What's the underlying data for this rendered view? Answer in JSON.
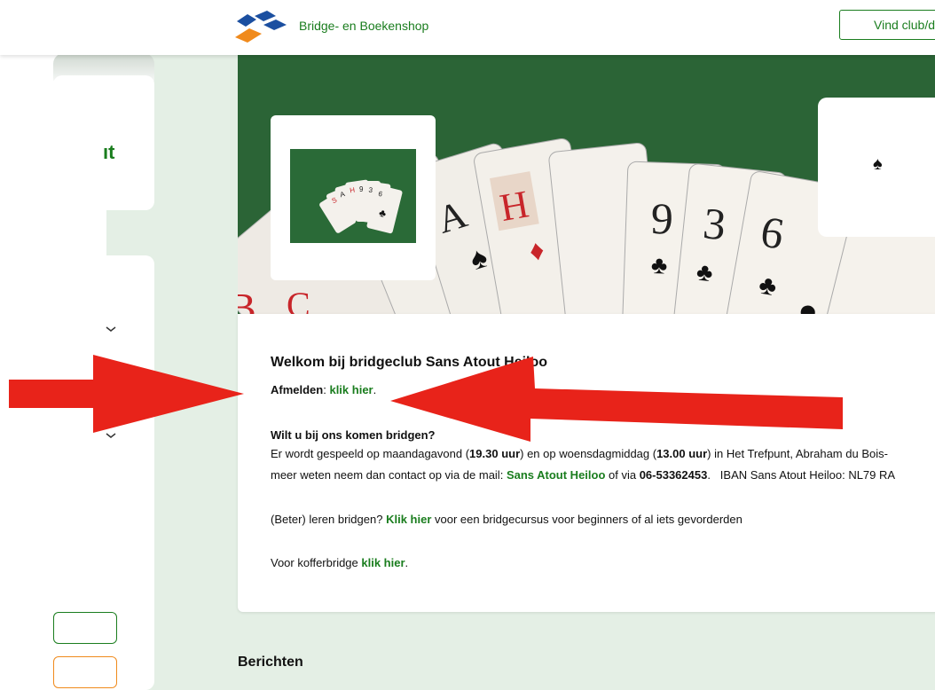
{
  "header": {
    "brand": "Bridge- en Boekenshop",
    "cta_label": "Vind club/d"
  },
  "sidebar": {
    "fragment_text": "ıt"
  },
  "hero": {
    "spade_symbol": "♠"
  },
  "content": {
    "title": "Welkom bij bridgeclub Sans Atout Heiloo",
    "afmelden_label": "Afmelden",
    "afmelden_link": "klik hier",
    "question": "Wilt u bij ons komen bridgen?",
    "p1_part1": "Er wordt gespeeld op maandagavond (",
    "time1": "19.30 uur",
    "p1_part2": ") en op woensdagmiddag (",
    "time2": "13.00 uur",
    "p1_part3": ") in Het Trefpunt, Abraham du Bois-",
    "p2_part1": "meer weten neem dan contact op via de mail: ",
    "mail_link": "Sans Atout Heiloo",
    "p2_part2": " of via ",
    "phone": "06-53362453",
    "p2_part3": ".   IBAN Sans Atout Heiloo: NL79 RA",
    "p3_part1": "(Beter) leren bridgen? ",
    "p3_link": "Klik hier",
    "p3_part2": " voor een bridgecursus voor beginners of al iets gevorderden",
    "p4_part1": "Voor kofferbridge ",
    "p4_link": "klik hier"
  },
  "section": {
    "berichten": "Berichten"
  },
  "colors": {
    "accent_green": "#1a7d1e",
    "annotation_red": "#e8231a",
    "background": "#e4efe5",
    "logo_blue": "#1b4fa0",
    "logo_orange": "#f08a1c"
  }
}
